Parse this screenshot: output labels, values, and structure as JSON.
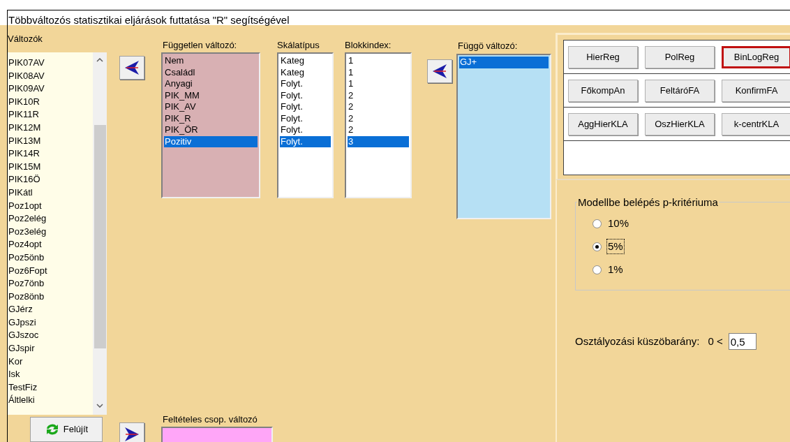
{
  "window": {
    "title": "Többváltozós statisztikai eljárások futtatása \"R\" segítségével"
  },
  "variables": {
    "label": "Változók",
    "items": [
      "PIK07AV",
      "PIK08AV",
      "PIK09AV",
      "PIK10R",
      "PIK11R",
      "PIK12M",
      "PIK13M",
      "PIK14R",
      "PIK15M",
      "PIK16Ö",
      "PIKátl",
      "Poz1opt",
      "Poz2elég",
      "Poz3elég",
      "Poz4opt",
      "Poz5önb",
      "Poz6Fopt",
      "Poz7önb",
      "Poz8önb",
      "GJérz",
      "GJpszi",
      "GJszoc",
      "GJspir",
      "Kor",
      "Isk",
      "TestFiz",
      "Áltlelki"
    ]
  },
  "independent": {
    "label": "Független változó:",
    "items": [
      {
        "text": "Nem",
        "selected": false
      },
      {
        "text": "Családl",
        "selected": false
      },
      {
        "text": "Anyagi",
        "selected": false
      },
      {
        "text": "PIK_MM",
        "selected": false
      },
      {
        "text": "PIK_AV",
        "selected": false
      },
      {
        "text": "PIK_R",
        "selected": false
      },
      {
        "text": "PIK_ÖR",
        "selected": false
      },
      {
        "text": "Pozitiv",
        "selected": true
      }
    ]
  },
  "scale_type": {
    "label": "Skálatípus",
    "items": [
      {
        "text": "Kateg",
        "selected": false
      },
      {
        "text": "Kateg",
        "selected": false
      },
      {
        "text": "Folyt.",
        "selected": false
      },
      {
        "text": "Folyt.",
        "selected": false
      },
      {
        "text": "Folyt.",
        "selected": false
      },
      {
        "text": "Folyt.",
        "selected": false
      },
      {
        "text": "Folyt.",
        "selected": false
      },
      {
        "text": "Folyt.",
        "selected": true
      }
    ]
  },
  "block_index": {
    "label": "Blokkindex:",
    "items": [
      {
        "text": "1",
        "selected": false
      },
      {
        "text": "1",
        "selected": false
      },
      {
        "text": "1",
        "selected": false
      },
      {
        "text": "2",
        "selected": false
      },
      {
        "text": "2",
        "selected": false
      },
      {
        "text": "2",
        "selected": false
      },
      {
        "text": "2",
        "selected": false
      },
      {
        "text": "3",
        "selected": true
      }
    ]
  },
  "dependent": {
    "label": "Függö változó:",
    "items": [
      {
        "text": "GJ+",
        "selected": true
      }
    ]
  },
  "method_rows": [
    [
      {
        "label": "HierReg",
        "selected": false
      },
      {
        "label": "PolReg",
        "selected": false
      },
      {
        "label": "BinLogReg",
        "selected": true
      }
    ],
    [
      {
        "label": "FőkompAn",
        "selected": false
      },
      {
        "label": "FeltáróFA",
        "selected": false
      },
      {
        "label": "KonfirmFA",
        "selected": false
      }
    ],
    [
      {
        "label": "AggHierKLA",
        "selected": false
      },
      {
        "label": "OszHierKLA",
        "selected": false
      },
      {
        "label": "k-centrKLA",
        "selected": false
      }
    ]
  ],
  "p_criterion": {
    "label": "Modellbe belépés p-kritériuma",
    "options": [
      {
        "label": "10%",
        "selected": false
      },
      {
        "label": "5%",
        "selected": true
      },
      {
        "label": "1%",
        "selected": false
      }
    ]
  },
  "threshold": {
    "label": "Osztályozási küszöbarány:",
    "prefix": "0 <",
    "value": "0,5"
  },
  "refresh_button": {
    "label": "Felújít"
  },
  "conditional": {
    "label": "Feltételes csop. változó"
  }
}
